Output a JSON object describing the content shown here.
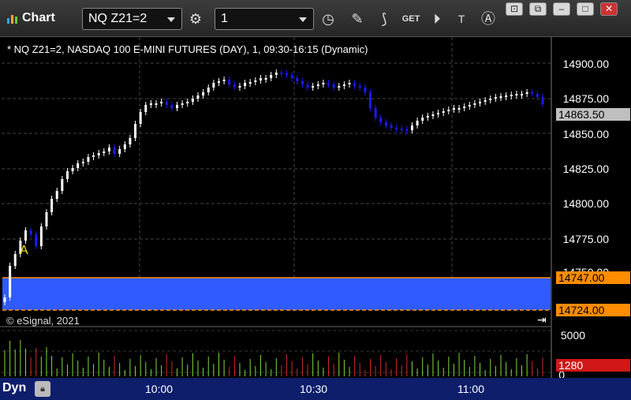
{
  "window": {
    "title": "Chart",
    "symbol_value": "NQ Z21=2",
    "interval_value": "1",
    "toolbar_icons": [
      "gear-icon",
      "clock-icon",
      "pencil-icon",
      "study-icon",
      "get-icon",
      "play-icon",
      "text-icon",
      "alert-icon"
    ],
    "window_buttons": [
      "restore-icon",
      "cascade-icon",
      "minimize-icon",
      "close-icon"
    ]
  },
  "chart": {
    "header": "* NQ Z21=2, NASDAQ 100 E-MINI FUTURES (DAY), 1, 09:30-16:15 (Dynamic)",
    "copyright": "© eSignal, 2021",
    "mode_label": "Dyn",
    "marker_label": "A",
    "price_axis": [
      "14900.00",
      "14875.00",
      "14850.00",
      "14825.00",
      "14800.00",
      "14775.00",
      "14750.00"
    ],
    "price_tags": {
      "last": "14863.50",
      "band_top": "14747.00",
      "band_bottom": "14724.00",
      "volume_last": "1280"
    },
    "volume_axis": [
      "5000",
      "0"
    ],
    "time_axis": [
      "10:00",
      "10:30",
      "11:00"
    ],
    "colors": {
      "background": "#000000",
      "up_candle": "#ffffff",
      "down_candle": "#1a1aff",
      "band": "#2f5bff",
      "band_line": "#ff8c00",
      "axis_tag_orange": "#ff8c00",
      "last_tag": "#bfbfbf",
      "volume_up": "#7fdb3a",
      "volume_down": "#d22a2a",
      "xaxis_bar": "#0e1e6b"
    }
  }
}
